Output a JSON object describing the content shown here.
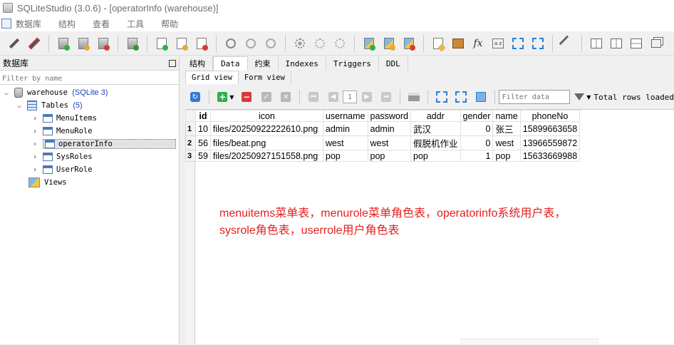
{
  "window": {
    "title": "SQLiteStudio (3.0.6) - [operatorInfo (warehouse)]"
  },
  "menu": {
    "items": [
      "数据库",
      "结构",
      "查看",
      "工具",
      "帮助"
    ]
  },
  "left_panel": {
    "title": "数据库",
    "filter_placeholder": "Filter by name",
    "db_name": "warehouse",
    "db_version": "(SQLite 3)",
    "tables_label": "Tables",
    "tables_count": "(5)",
    "tables": [
      "MenuItems",
      "MenuRole",
      "operatorInfo",
      "SysRoles",
      "UserRole"
    ],
    "selected_table": "operatorInfo",
    "views_label": "Views"
  },
  "tabs": [
    "结构",
    "Data",
    "约束",
    "Indexes",
    "Triggers",
    "DDL"
  ],
  "active_tab": "Data",
  "subtabs": [
    "Grid view",
    "Form view"
  ],
  "active_subtab": "Grid view",
  "grid_toolbar": {
    "page_number": "1",
    "filter_placeholder": "Filter data",
    "total_rows_label": "Total rows loaded"
  },
  "grid": {
    "columns": [
      "id",
      "icon",
      "username",
      "password",
      "addr",
      "gender",
      "name",
      "phoneNo"
    ],
    "rows": [
      {
        "rownum": "1",
        "cells": [
          "10",
          "files/20250922222610.png",
          "admin",
          "admin",
          "武汉",
          "0",
          "张三",
          "15899663658"
        ]
      },
      {
        "rownum": "2",
        "cells": [
          "56",
          "files/beat.png",
          "west",
          "west",
          "假脱机作业",
          "0",
          "west",
          "13966559872"
        ]
      },
      {
        "rownum": "3",
        "cells": [
          "59",
          "files/20250927151558.png",
          "pop",
          "pop",
          "pop",
          "1",
          "pop",
          "15633669988"
        ]
      }
    ]
  },
  "annotation": {
    "line1": "menuitems菜单表，menurole菜单角色表，operatorinfo系统用户表，",
    "line2": "sysrole角色表，userrole用户角色表"
  },
  "colors": {
    "annotation": "#e42020",
    "version_blue": "#1e3fbd"
  }
}
